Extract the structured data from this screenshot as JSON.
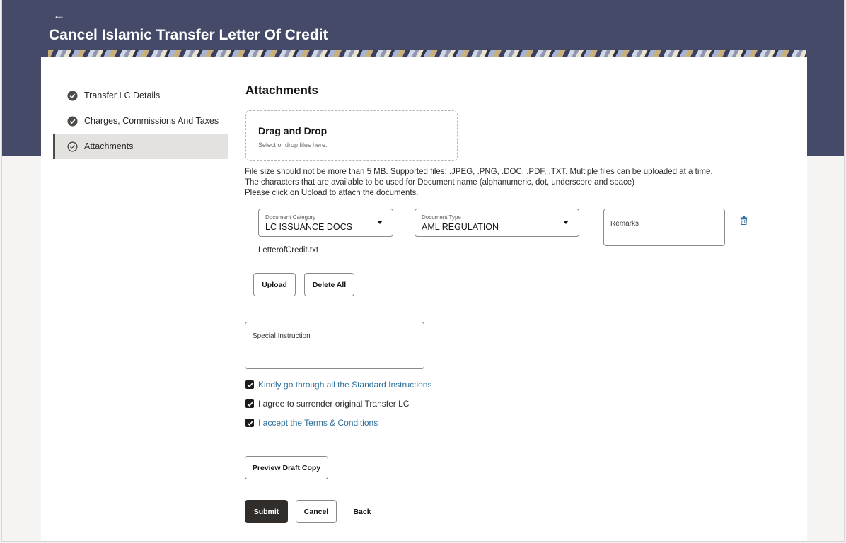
{
  "header": {
    "back_icon": "arrow-left-icon",
    "title": "Cancel Islamic Transfer Letter Of Credit"
  },
  "steps": [
    {
      "label": "Transfer LC Details",
      "icon": "check-circle-filled-icon",
      "state": "completed"
    },
    {
      "label": "Charges, Commissions And Taxes",
      "icon": "check-circle-filled-icon",
      "state": "completed"
    },
    {
      "label": "Attachments",
      "icon": "check-circle-outline-icon",
      "state": "active"
    }
  ],
  "attachments": {
    "title": "Attachments",
    "dropzone": {
      "title": "Drag and Drop",
      "hint": "Select or drop files here."
    },
    "info": [
      "File size should not be more than 5 MB. Supported files: .JPEG, .PNG, .DOC, .PDF, .TXT. Multiple files can be uploaded at a time.",
      "The characters that are available to be used for Document name (alphanumeric, dot, underscore and space)",
      "Please click on Upload to attach the documents."
    ],
    "document_category": {
      "label": "Document Category",
      "value": "LC ISSUANCE DOCS"
    },
    "document_type": {
      "label": "Document Type",
      "value": "AML REGULATION"
    },
    "remarks_placeholder": "Remarks",
    "delete_icon": "trash-icon",
    "file_name": "LetterofCredit.txt",
    "upload_label": "Upload",
    "delete_all_label": "Delete All"
  },
  "special_instruction": {
    "placeholder": "Special Instruction"
  },
  "checkboxes": [
    {
      "label": "Kindly go through all the Standard Instructions",
      "checked": true,
      "is_link": true
    },
    {
      "label": "I agree to surrender original Transfer LC",
      "checked": true,
      "is_link": false
    },
    {
      "label": "I accept the Terms & Conditions",
      "checked": true,
      "is_link": true
    }
  ],
  "actions": {
    "preview_label": "Preview Draft Copy",
    "submit_label": "Submit",
    "cancel_label": "Cancel",
    "back_label": "Back"
  },
  "colors": {
    "header_bg": "#444a68",
    "primary_button": "#312d2a",
    "link": "#2f6f9a",
    "active_step_bg": "#e4e2df"
  }
}
